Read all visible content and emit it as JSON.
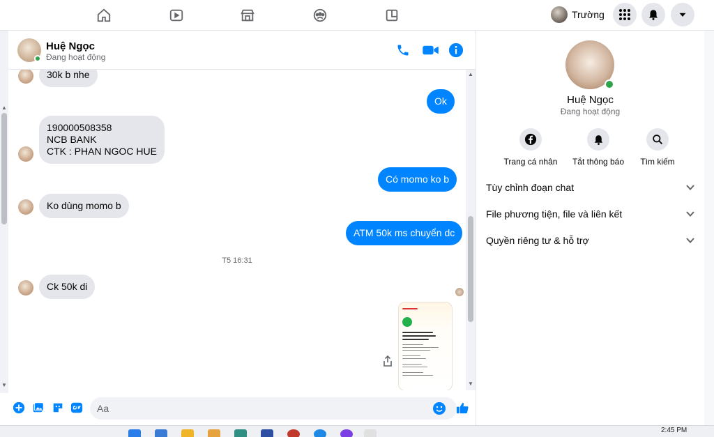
{
  "user": {
    "name": "Trường"
  },
  "contact": {
    "name": "Huệ Ngọc",
    "status": "Đang hoạt động"
  },
  "messages": [
    {
      "dir": "in",
      "text": "30k b nhe"
    },
    {
      "dir": "out",
      "text": "Ok"
    },
    {
      "dir": "in",
      "lines": [
        "190000508358",
        "NCB BANK",
        "CTK : PHAN NGOC HUE"
      ]
    },
    {
      "dir": "out",
      "text": "Có momo ko b"
    },
    {
      "dir": "in",
      "text": "Ko dùng momo b"
    },
    {
      "dir": "out",
      "text": "ATM 50k ms chuyển dc"
    },
    {
      "dir": "in",
      "text": "Ck 50k di"
    }
  ],
  "timestamp": "T5 16:31",
  "composer": {
    "placeholder": "Aa"
  },
  "right_panel": {
    "actions": [
      {
        "label": "Trang cá nhân",
        "icon": "facebook-icon"
      },
      {
        "label": "Tắt thông báo",
        "icon": "bell-icon"
      },
      {
        "label": "Tìm kiếm",
        "icon": "search-icon"
      }
    ],
    "sections": [
      {
        "label": "Tùy chỉnh đoạn chat"
      },
      {
        "label": "File phương tiện, file và liên kết"
      },
      {
        "label": "Quyền riêng tư & hỗ trợ"
      }
    ]
  },
  "taskbar": {
    "time": "2:45 PM"
  },
  "colors": {
    "accent": "#0084ff",
    "online": "#31a24c",
    "in_bubble": "#e4e6eb"
  }
}
